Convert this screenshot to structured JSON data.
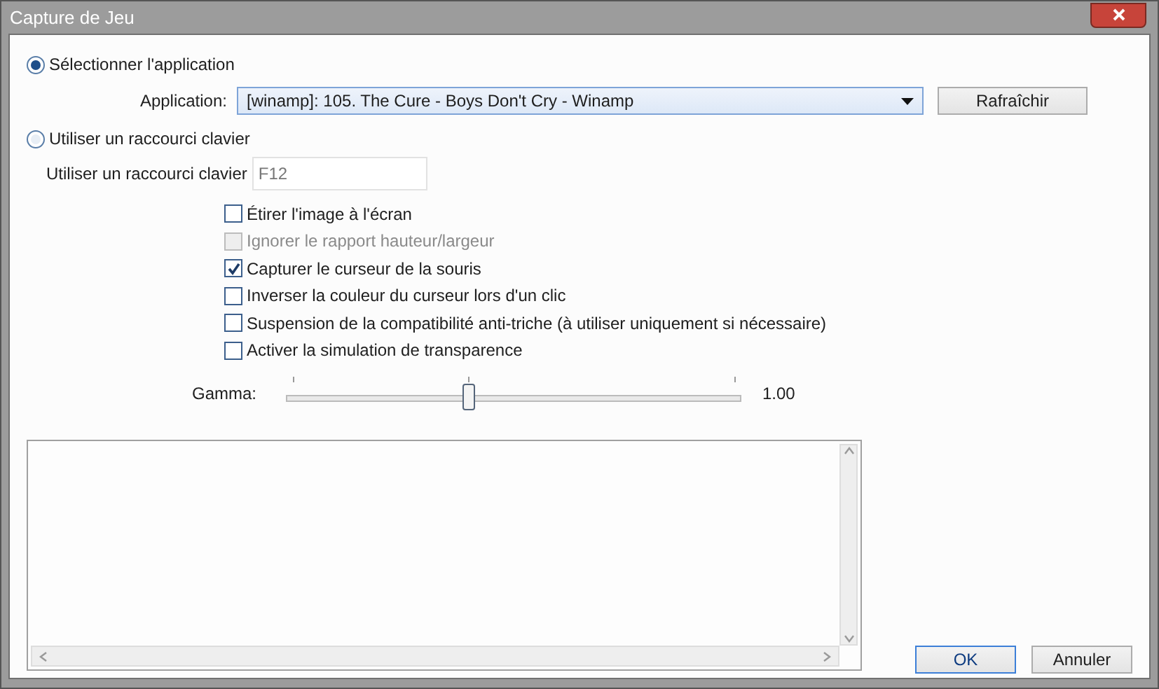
{
  "window": {
    "title": "Capture de Jeu"
  },
  "modes": [
    {
      "label": "Sélectionner l'application",
      "selected": true
    },
    {
      "label": "Utiliser un raccourci clavier",
      "selected": false
    }
  ],
  "application": {
    "label": "Application:",
    "value": "[winamp]: 105. The Cure - Boys Don't Cry - Winamp",
    "refresh_button": "Rafraîchir"
  },
  "hotkey": {
    "label": "Utiliser un raccourci clavier",
    "value": "F12"
  },
  "options": [
    {
      "label": "Étirer l'image à l'écran",
      "checked": false,
      "disabled": false
    },
    {
      "label": "Ignorer le rapport hauteur/largeur",
      "checked": false,
      "disabled": true
    },
    {
      "label": "Capturer le curseur de la souris",
      "checked": true,
      "disabled": false
    },
    {
      "label": "Inverser la couleur du curseur lors d'un clic",
      "checked": false,
      "disabled": false
    },
    {
      "label": "Suspension de la compatibilité anti-triche (à utiliser uniquement si nécessaire)",
      "checked": false,
      "disabled": false
    },
    {
      "label": "Activer la simulation de transparence",
      "checked": false,
      "disabled": false
    }
  ],
  "gamma": {
    "label": "Gamma:",
    "level": 0.4,
    "reading": "1.00"
  },
  "buttons": [
    {
      "label": "OK",
      "kind": "default"
    },
    {
      "label": "Annuler",
      "kind": "normal"
    }
  ]
}
